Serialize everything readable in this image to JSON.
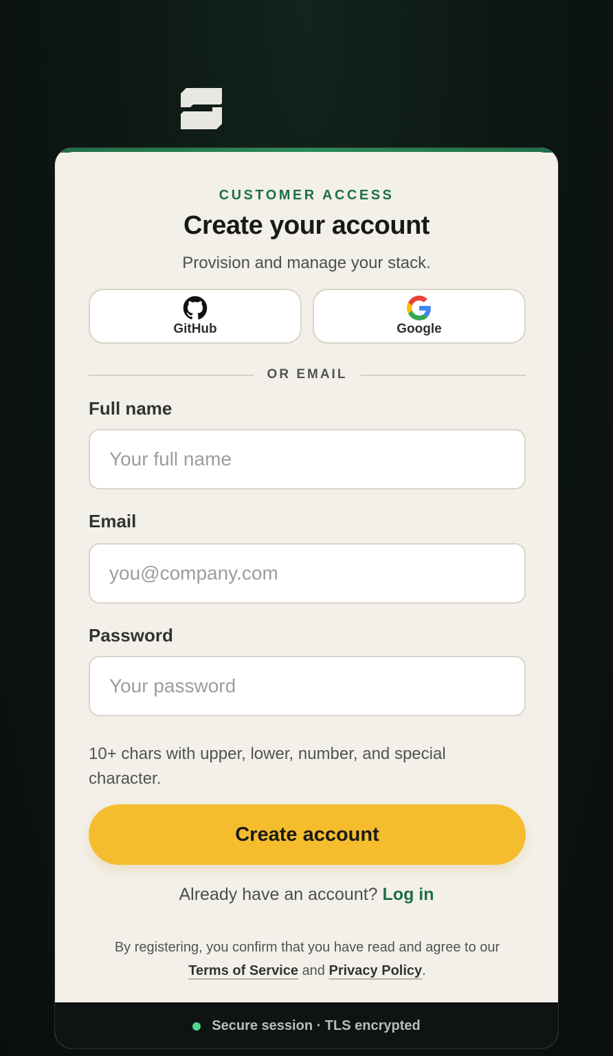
{
  "brand": {
    "logo_icon": "stacked-s-logo-icon"
  },
  "header": {
    "eyebrow": "CUSTOMER ACCESS",
    "title": "Create your account",
    "subtitle": "Provision and manage your stack."
  },
  "oauth": [
    {
      "label": "GitHub",
      "icon": "github-icon"
    },
    {
      "label": "Google",
      "icon": "google-icon"
    }
  ],
  "divider": {
    "text": "OR EMAIL"
  },
  "form": {
    "full_name": {
      "label": "Full name",
      "placeholder": "Your full name",
      "value": ""
    },
    "email": {
      "label": "Email",
      "placeholder": "you@company.com",
      "value": ""
    },
    "password": {
      "label": "Password",
      "placeholder": "Your password",
      "value": ""
    },
    "hint": "10+ chars with upper, lower, number, and special character.",
    "submit_label": "Create account"
  },
  "login": {
    "prompt": "Already have an account?",
    "link": "Log in"
  },
  "legal": {
    "prefix": "By registering, you confirm that you have read and agree to our",
    "terms": "Terms of Service",
    "and": "and",
    "privacy": "Privacy Policy",
    "suffix": "."
  },
  "footer": {
    "status": "Secure session · TLS encrypted",
    "status_color": "#4fd88a"
  },
  "colors": {
    "accent": "#1f6e45",
    "button": "#f5bd2e",
    "card_bg": "#f3f0e9",
    "page_bg": "#0c1512"
  }
}
